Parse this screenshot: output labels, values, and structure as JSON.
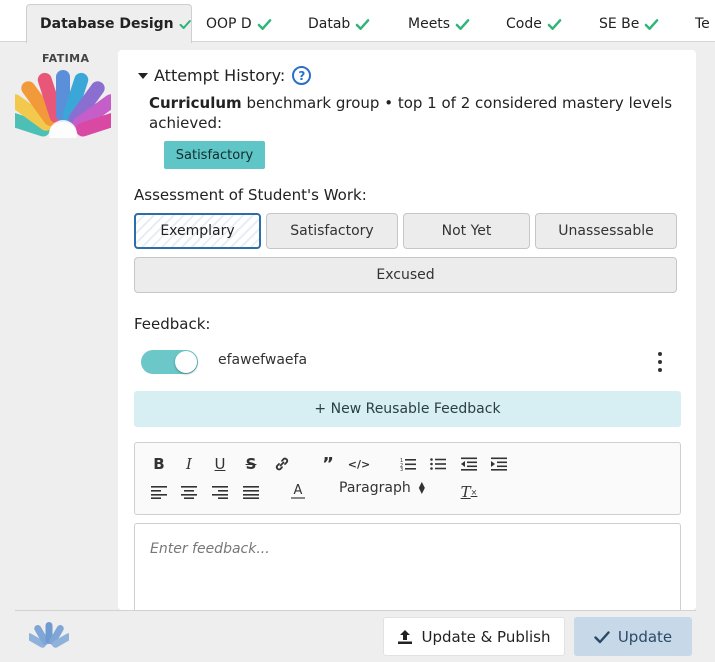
{
  "tabs": [
    {
      "label": "Database Design",
      "complete": true,
      "active": true
    },
    {
      "label": "OOP D",
      "complete": true
    },
    {
      "label": "Datab",
      "complete": true
    },
    {
      "label": "Meets",
      "complete": true
    },
    {
      "label": "Code",
      "complete": true
    },
    {
      "label": "SE Be",
      "complete": true
    },
    {
      "label": "Te",
      "complete": false
    }
  ],
  "student": {
    "name": "FATIMA"
  },
  "attempt": {
    "heading": "Attempt History:",
    "curriculum_label": "Curriculum",
    "curriculum_text": "benchmark group • top 1 of 2 considered mastery levels achieved:",
    "level_badge": "Satisfactory"
  },
  "assessment": {
    "label": "Assessment of Student's Work:",
    "options": [
      "Exemplary",
      "Satisfactory",
      "Not Yet",
      "Unassessable",
      "Excused"
    ],
    "selected": "Exemplary"
  },
  "feedback": {
    "label": "Feedback:",
    "saved_item": "efawefwaefa",
    "toggle_on": true,
    "new_button": "+ New Reusable Feedback",
    "format_select": "Paragraph",
    "placeholder": "Enter feedback..."
  },
  "footer": {
    "publish_button": "Update & Publish",
    "update_button": "Update"
  },
  "colors": {
    "accent_teal": "#5fc5c6",
    "check_green": "#2fb57a",
    "selected_border": "#2f6da8",
    "update_bg": "#c7d8e8",
    "help_blue": "#2a6fc9"
  }
}
